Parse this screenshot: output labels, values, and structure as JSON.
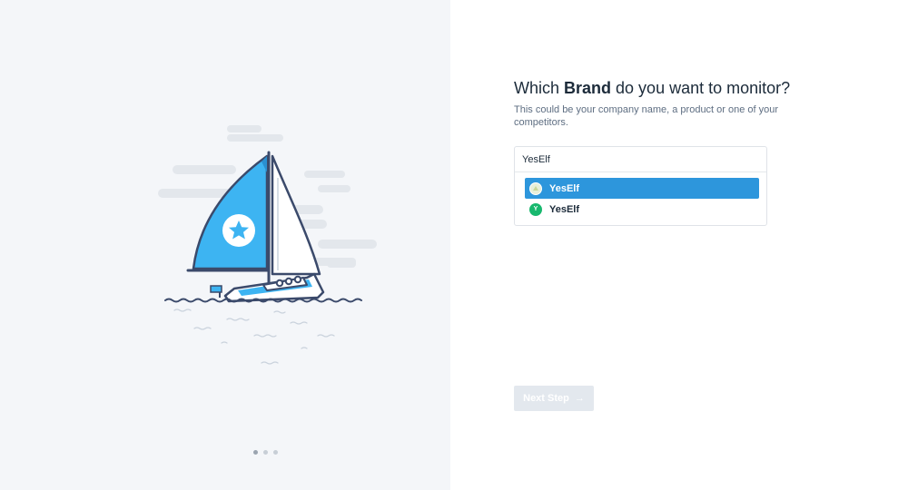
{
  "heading": {
    "prefix": "Which ",
    "emphasis": "Brand",
    "suffix": " do you want to monitor?"
  },
  "subtext": "This could be your company name, a product or one of your competitors.",
  "brand_input": {
    "value": "YesElf"
  },
  "suggestions": [
    {
      "label": "YesElf",
      "icon": "brand-logo-icon",
      "selected": true
    },
    {
      "label": "YesElf",
      "icon_letter": "Y",
      "icon": "letter-avatar-icon",
      "selected": false
    }
  ],
  "next_button": {
    "label": "Next Step",
    "arrow": "→"
  },
  "pager": {
    "total": 3,
    "current": 1
  },
  "colors": {
    "accent": "#2d96dc",
    "sail": "#3db4f2",
    "green": "#18b86e",
    "left_bg": "#f4f6f9"
  }
}
